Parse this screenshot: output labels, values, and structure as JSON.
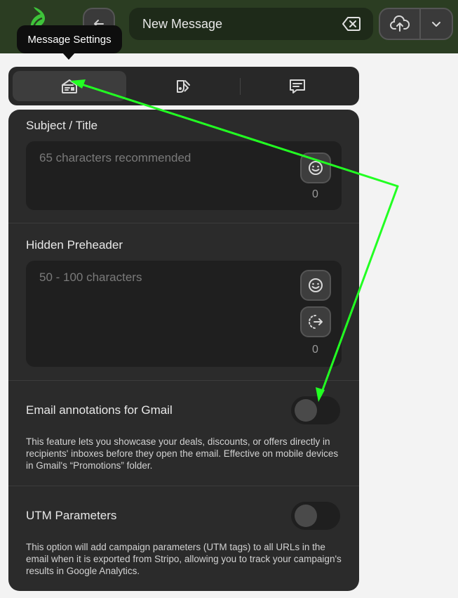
{
  "header": {
    "title_value": "New Message"
  },
  "tooltip": {
    "text": "Message Settings"
  },
  "tabs": [
    {
      "icon": "envelope-settings-icon",
      "active": true
    },
    {
      "icon": "paint-tag-icon",
      "active": false
    },
    {
      "icon": "comment-icon",
      "active": false
    }
  ],
  "subject": {
    "label": "Subject / Title",
    "placeholder": "65 characters recommended",
    "count": "0"
  },
  "preheader": {
    "label": "Hidden Preheader",
    "placeholder": "50 - 100 characters",
    "count": "0"
  },
  "annotations": {
    "label": "Email annotations for Gmail",
    "description": "This feature lets you showcase your deals, discounts, or offers directly in recipients' inboxes before they open the email. Effective on mobile devices in Gmail's “Promotions” folder.",
    "enabled": false
  },
  "utm": {
    "label": "UTM Parameters",
    "description": "This option will add campaign parameters (UTM tags) to all URLs in the email when it is exported from Stripo, allowing you to track your campaign's results in Google Analytics.",
    "enabled": false
  },
  "colors": {
    "header_bg": "#2b3d22",
    "panel_bg": "#2b2b2b",
    "annotation_arrow": "#22ff22",
    "logo_green": "#3ec43a"
  }
}
